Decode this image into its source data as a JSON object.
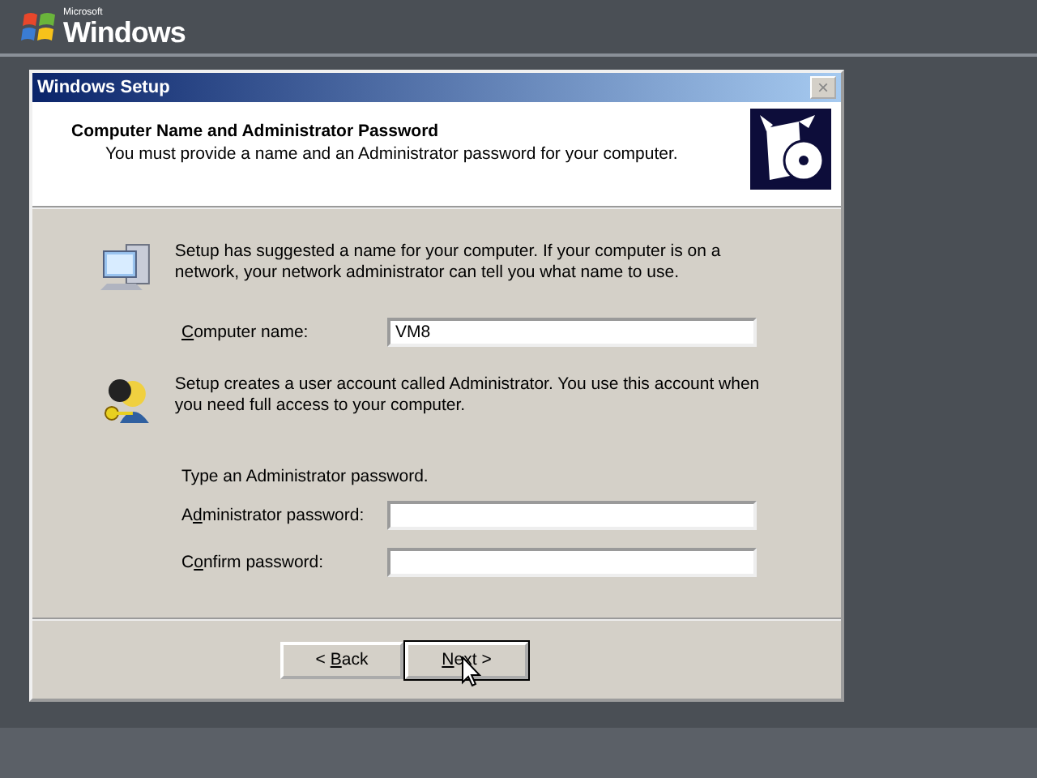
{
  "brand": {
    "maker": "Microsoft",
    "product": "Windows"
  },
  "window": {
    "title": "Windows Setup",
    "close": "×"
  },
  "header": {
    "title": "Computer Name and Administrator Password",
    "subtitle": "You must provide a name and an Administrator password for your computer."
  },
  "sections": [
    {
      "kind": "computer",
      "text": "Setup has suggested a name for your computer.  If your computer is on a network, your network administrator can tell you what name to use.",
      "fields": [
        {
          "label": {
            "key": "C",
            "after": "omputer name:"
          },
          "value": "VM8"
        }
      ]
    },
    {
      "kind": "account",
      "text": "Setup creates a user account called Administrator.  You use this account when you need full access to your computer.",
      "prompt": "Type an Administrator password.",
      "fields": [
        {
          "label": {
            "before": "A",
            "key": "d",
            "after": "ministrator password:"
          }
        },
        {
          "label": {
            "before": "C",
            "key": "o",
            "after": "nfirm password:"
          }
        }
      ]
    }
  ],
  "buttons": [
    {
      "label": {
        "before": "< ",
        "key": "B",
        "after": "ack"
      },
      "default": false
    },
    {
      "label": {
        "key": "N",
        "after": "ext >"
      },
      "default": true
    }
  ]
}
